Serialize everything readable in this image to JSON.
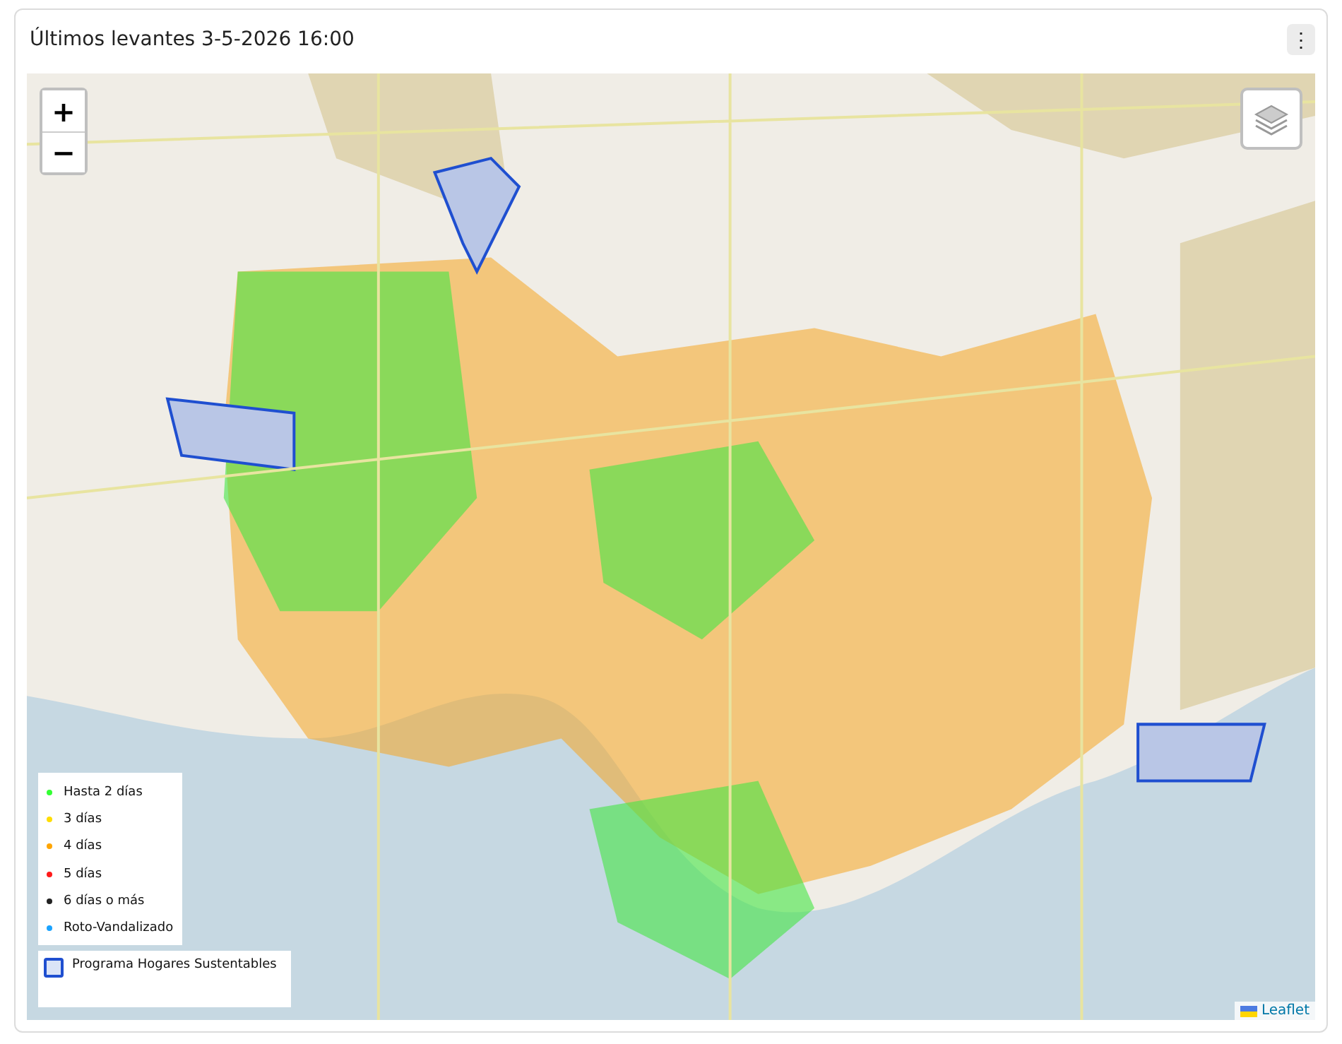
{
  "card": {
    "title": "Últimos levantes 3-5-2026 16:00",
    "menu_button": "⋮"
  },
  "map": {
    "zoom_in": "+",
    "zoom_out": "−",
    "legend": [
      {
        "label": "Hasta 2 días",
        "color": "#33ff33"
      },
      {
        "label": "3 días",
        "color": "#ffdd00"
      },
      {
        "label": "4 días",
        "color": "#ffa500"
      },
      {
        "label": "5 días",
        "color": "#ff1a1a"
      },
      {
        "label": "6 días o más",
        "color": "#222222"
      },
      {
        "label": "Roto-Vandalizado",
        "color": "#1aa3ff"
      }
    ],
    "area_legend": {
      "label": "Programa Hogares Sustentables"
    },
    "attribution": "Leaflet"
  }
}
